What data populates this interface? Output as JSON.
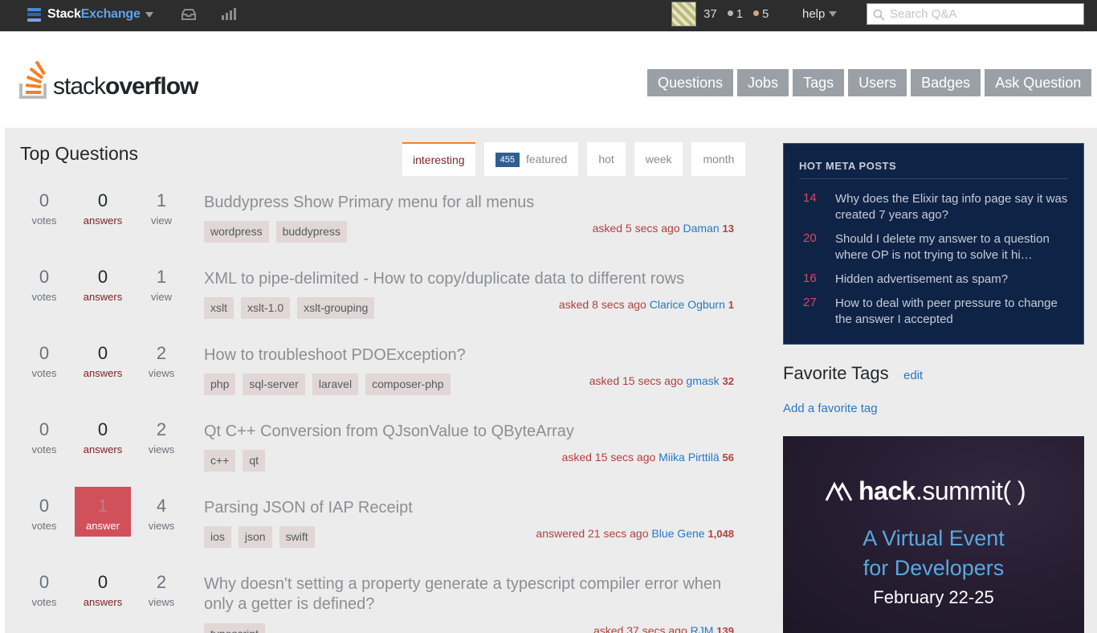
{
  "topbar": {
    "brand_part1": "Stack",
    "brand_part2": "Exchange",
    "reputation": "37",
    "silver_badges": "1",
    "bronze_badges": "5",
    "help_label": "help",
    "search_placeholder": "Search Q&A",
    "colors": {
      "bar": "#2d2d2d",
      "silver": "#b4b8bc",
      "bronze": "#d1a684"
    }
  },
  "header": {
    "logo_part1": "stack",
    "logo_part2": "overflow",
    "nav": [
      "Questions",
      "Jobs",
      "Tags",
      "Users",
      "Badges",
      "Ask Question"
    ]
  },
  "main": {
    "title": "Top Questions",
    "tabs": {
      "interesting": "interesting",
      "featured_count": "455",
      "featured": "featured",
      "hot": "hot",
      "week": "week",
      "month": "month"
    },
    "questions": [
      {
        "votes": "0",
        "votes_label": "votes",
        "answers": "0",
        "answers_label": "answers",
        "views": "1",
        "views_label": "view",
        "title": "Buddypress Show Primary menu for all menus",
        "tags": [
          "wordpress",
          "buddypress"
        ],
        "action": "asked 5 secs ago",
        "user": "Daman",
        "rep": "13"
      },
      {
        "votes": "0",
        "votes_label": "votes",
        "answers": "0",
        "answers_label": "answers",
        "views": "1",
        "views_label": "view",
        "title": "XML to pipe-delimited - How to copy/duplicate data to different rows",
        "tags": [
          "xslt",
          "xslt-1.0",
          "xslt-grouping"
        ],
        "action": "asked 8 secs ago",
        "user": "Clarice Ogburn",
        "rep": "1"
      },
      {
        "votes": "0",
        "votes_label": "votes",
        "answers": "0",
        "answers_label": "answers",
        "views": "2",
        "views_label": "views",
        "title": "How to troubleshoot PDOException?",
        "tags": [
          "php",
          "sql-server",
          "laravel",
          "composer-php"
        ],
        "action": "asked 15 secs ago",
        "user": "gmask",
        "rep": "32"
      },
      {
        "votes": "0",
        "votes_label": "votes",
        "answers": "0",
        "answers_label": "answers",
        "views": "2",
        "views_label": "views",
        "title": "Qt C++ Conversion from QJsonValue to QByteArray",
        "tags": [
          "c++",
          "qt"
        ],
        "action": "asked 15 secs ago",
        "user": "Miika Pirttilä",
        "rep": "56"
      },
      {
        "votes": "0",
        "votes_label": "votes",
        "answers": "1",
        "answers_label": "answer",
        "views": "4",
        "views_label": "views",
        "title": "Parsing JSON of IAP Receipt",
        "tags": [
          "ios",
          "json",
          "swift"
        ],
        "action": "answered 21 secs ago",
        "user": "Blue Gene",
        "rep": "1,048"
      },
      {
        "votes": "0",
        "votes_label": "votes",
        "answers": "0",
        "answers_label": "answers",
        "views": "2",
        "views_label": "views",
        "title": "Why doesn't setting a property generate a typescript compiler error when only a getter is defined?",
        "tags": [
          "typescript"
        ],
        "action": "asked 37 secs ago",
        "user": "RJM",
        "rep": "139"
      }
    ]
  },
  "sidebar": {
    "meta_title": "HOT META POSTS",
    "meta_posts": [
      {
        "count": "14",
        "title": "Why does the Elixir tag info page say it was created 7 years ago?"
      },
      {
        "count": "20",
        "title": "Should I delete my answer to a question where OP is not trying to solve it hi…"
      },
      {
        "count": "16",
        "title": "Hidden advertisement as spam?"
      },
      {
        "count": "27",
        "title": "How to deal with peer pressure to change the answer I accepted"
      }
    ],
    "fav_title": "Favorite Tags",
    "fav_edit": "edit",
    "fav_add": "Add a favorite tag",
    "ad": {
      "brand_part1": "hack",
      "brand_part2": ".summit( )",
      "line1": "A Virtual Event",
      "line2": "for Developers",
      "date": "February 22-25"
    }
  }
}
